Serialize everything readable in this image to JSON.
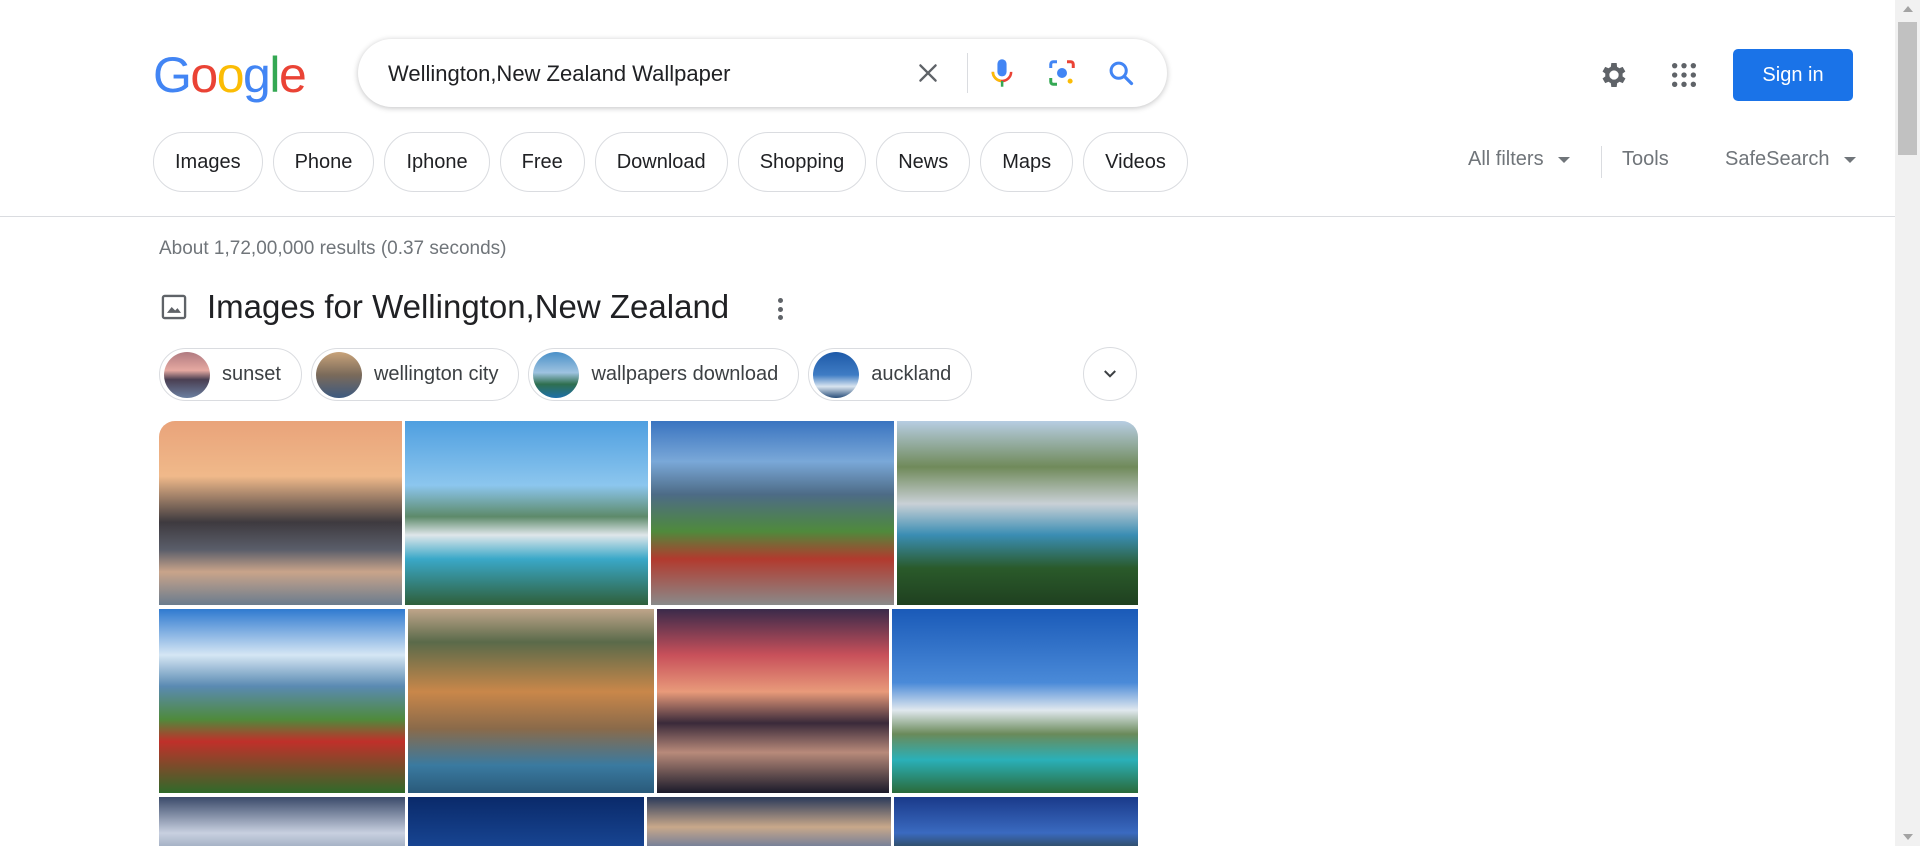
{
  "logo": {
    "letters": [
      "G",
      "o",
      "o",
      "g",
      "l",
      "e"
    ]
  },
  "search": {
    "query": "Wellington,New Zealand Wallpaper"
  },
  "header": {
    "sign_in": "Sign in"
  },
  "chips": [
    "Images",
    "Phone",
    "Iphone",
    "Free",
    "Download",
    "Shopping",
    "News",
    "Maps",
    "Videos"
  ],
  "filters": {
    "all_filters": "All filters",
    "tools": "Tools",
    "safesearch": "SafeSearch"
  },
  "results": {
    "stats": "About 1,72,00,000 results (0.37 seconds)"
  },
  "images_section": {
    "heading": "Images for Wellington,New Zealand",
    "refinements": [
      {
        "label": "sunset"
      },
      {
        "label": "wellington city"
      },
      {
        "label": "wallpapers download"
      },
      {
        "label": "auckland"
      }
    ]
  },
  "colors": {
    "accent": "#1a73e8",
    "text": "#202124",
    "muted": "#70757a",
    "border": "#dadce0"
  }
}
